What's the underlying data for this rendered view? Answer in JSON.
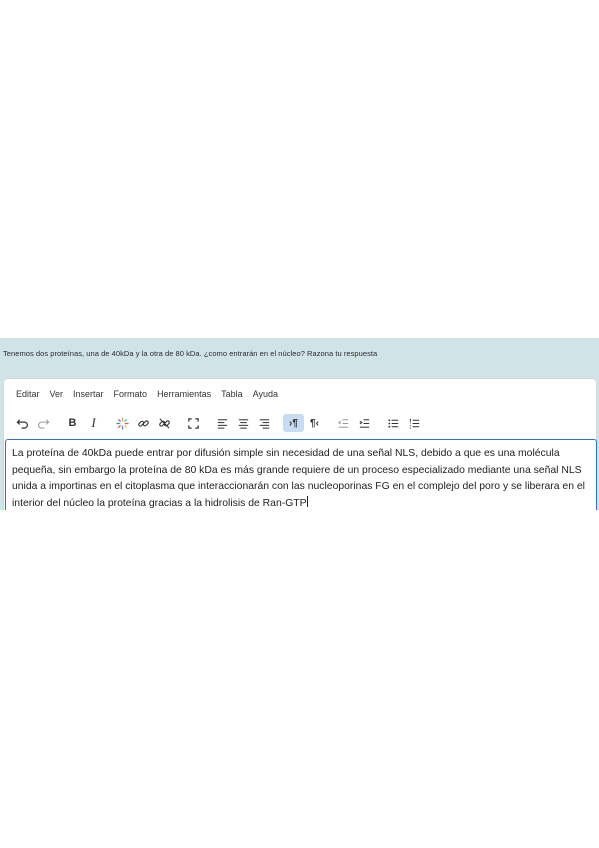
{
  "question": {
    "text": "Tenemos dos proteínas, una de 40kDa y la otra de 80 kDa. ¿como entrarán en el núcleo? Razona tu respuesta"
  },
  "menubar": {
    "items": [
      "Editar",
      "Ver",
      "Insertar",
      "Formato",
      "Herramientas",
      "Tabla",
      "Ayuda"
    ]
  },
  "toolbar": {
    "buttons": [
      {
        "name": "undo-icon",
        "glyph": "↶"
      },
      {
        "name": "redo-icon",
        "glyph": "↷"
      },
      {
        "name": "bold-icon",
        "glyph": "B"
      },
      {
        "name": "italic-icon",
        "glyph": "I"
      },
      {
        "name": "sparkle-icon",
        "glyph": "✳"
      },
      {
        "name": "link-icon",
        "glyph": "🔗"
      },
      {
        "name": "unlink-icon",
        "glyph": "⛓"
      },
      {
        "name": "fullscreen-icon",
        "glyph": "⛶"
      },
      {
        "name": "align-left-icon",
        "glyph": "≡"
      },
      {
        "name": "align-center-icon",
        "glyph": "≡"
      },
      {
        "name": "align-right-icon",
        "glyph": "≡"
      },
      {
        "name": "ltr-icon",
        "glyph": "¶"
      },
      {
        "name": "rtl-icon",
        "glyph": "¶"
      },
      {
        "name": "outdent-icon",
        "glyph": "⇤"
      },
      {
        "name": "indent-icon",
        "glyph": "⇥"
      },
      {
        "name": "bullet-list-icon",
        "glyph": "☰"
      },
      {
        "name": "numbered-list-icon",
        "glyph": "☷"
      }
    ]
  },
  "answer": {
    "text": "La proteína de 40kDa puede entrar por difusión simple sin necesidad de una señal NLS, debido a que es una molécula pequeña, sin embargo la proteína de 80 kDa es más grande requiere de un proceso especializado mediante una señal NLS unida a importinas en el citoplasma que interaccionarán con las nucleoporinas FG en el complejo del poro y se liberara en el interior del núcleo la proteína gracias a la hidrolisis de Ran-GTP"
  },
  "colors": {
    "panel_bg": "#d0e4e8",
    "focus_border": "#2f6fd6",
    "active_button": "#c6dcf2"
  }
}
